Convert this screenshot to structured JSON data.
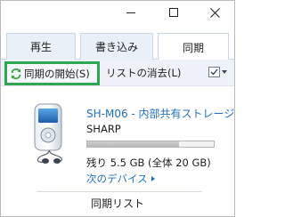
{
  "tabs": [
    {
      "label": "再生"
    },
    {
      "label": "書き込み"
    },
    {
      "label": "同期",
      "selected": true
    }
  ],
  "toolbar": {
    "start_sync_label": "同期の開始(S)",
    "clear_list_label": "リストの消去(L)",
    "sync_icon": "sync-arrows-icon",
    "options_icon": "checkbox-options-icon",
    "highlight_color": "#2ea84f"
  },
  "device": {
    "name": "SH-M06 - 内部共有ストレージ",
    "maker": "SHARP",
    "storage_text": "残り 5.5 GB (全体 20 GB)",
    "used_fraction": 0.725,
    "next_device_label": "次のデバイス",
    "link_color": "#1f6fc2"
  },
  "sync_list": {
    "title": "同期リスト"
  }
}
